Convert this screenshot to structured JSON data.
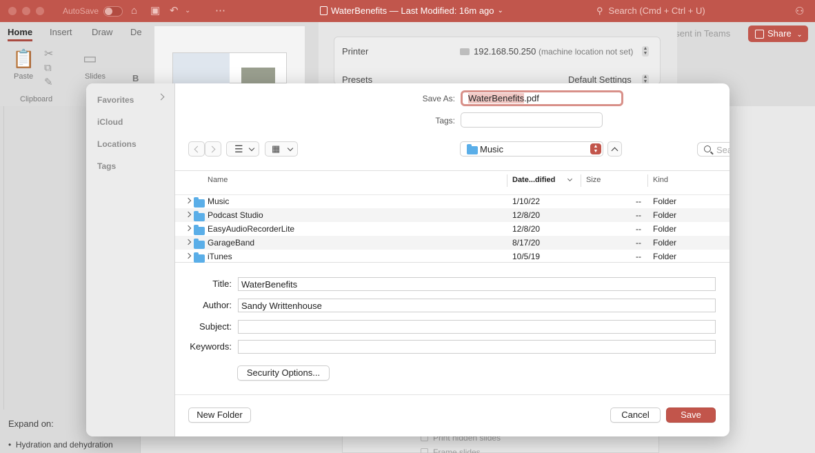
{
  "titlebar": {
    "autosave_label": "AutoSave",
    "document_title": "WaterBenefits — Last Modified: 16m ago",
    "search_placeholder": "Search (Cmd + Ctrl + U)"
  },
  "ribbon": {
    "tabs": [
      "Home",
      "Insert",
      "Draw",
      "De"
    ],
    "paste_label": "Paste",
    "slides_label": "Slides",
    "clipboard_label": "Clipboard",
    "bold_letter": "B",
    "present_in_teams": "esent in Teams",
    "share_label": "Share"
  },
  "notes": {
    "expand_label": "Expand on:",
    "bullet_1": "Hydration and dehydration"
  },
  "print_panel": {
    "printer_label": "Printer",
    "printer_value": "192.168.50.250",
    "printer_note": "(machine location not set)",
    "presets_label": "Presets",
    "presets_value": "Default Settings",
    "print_hidden_slides": "Print hidden slides",
    "frame_slides": "Frame slides"
  },
  "dialog": {
    "sidebar": [
      "Favorites",
      "iCloud",
      "Locations",
      "Tags"
    ],
    "save_as_label": "Save As:",
    "filename_selected": "WaterBenefits",
    "filename_ext": ".pdf",
    "tags_label": "Tags:",
    "location": "Music",
    "search_placeholder": "Search",
    "columns": {
      "name": "Name",
      "date": "Date...dified",
      "size": "Size",
      "kind": "Kind"
    },
    "files": [
      {
        "name": "Music",
        "date": "1/10/22",
        "size": "--",
        "kind": "Folder"
      },
      {
        "name": "Podcast Studio",
        "date": "12/8/20",
        "size": "--",
        "kind": "Folder"
      },
      {
        "name": "EasyAudioRecorderLite",
        "date": "12/8/20",
        "size": "--",
        "kind": "Folder"
      },
      {
        "name": "GarageBand",
        "date": "8/17/20",
        "size": "--",
        "kind": "Folder"
      },
      {
        "name": "iTunes",
        "date": "10/5/19",
        "size": "--",
        "kind": "Folder"
      }
    ],
    "meta": {
      "title_label": "Title:",
      "title_value": "WaterBenefits",
      "author_label": "Author:",
      "author_value": "Sandy Writtenhouse",
      "subject_label": "Subject:",
      "subject_value": "",
      "keywords_label": "Keywords:",
      "keywords_value": ""
    },
    "security_options": "Security Options...",
    "new_folder": "New Folder",
    "cancel": "Cancel",
    "save": "Save"
  }
}
